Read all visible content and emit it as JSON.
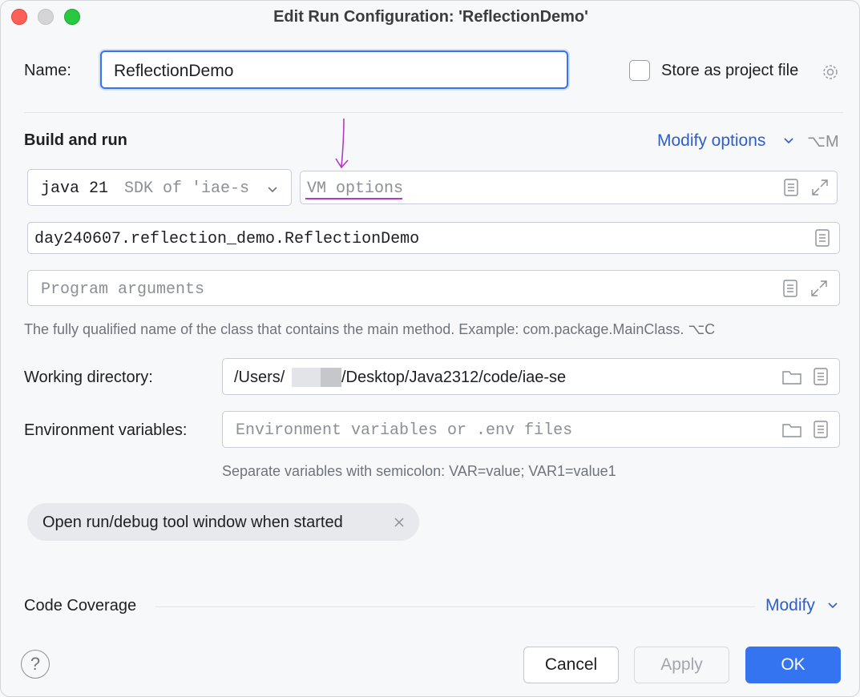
{
  "window": {
    "title": "Edit Run Configuration: 'ReflectionDemo'"
  },
  "name_row": {
    "label": "Name:",
    "value": "ReflectionDemo",
    "store_label": "Store as project file",
    "store_checked": false
  },
  "build_and_run": {
    "heading": "Build and run",
    "modify_options_label": "Modify options",
    "modify_options_shortcut": "⌥M",
    "sdk": {
      "main": "java 21",
      "detail": "SDK of 'iae-s"
    },
    "vm_options_placeholder": "VM options",
    "main_class_value": "day240607.reflection_demo.ReflectionDemo",
    "program_args_placeholder": "Program arguments",
    "main_class_hint": "The fully qualified name of the class that contains the main method. Example: com.package.MainClass. ⌥C"
  },
  "working_directory": {
    "label": "Working directory:",
    "value_prefix": "/Users/",
    "value_suffix": "/Desktop/Java2312/code/iae-se"
  },
  "environment": {
    "label": "Environment variables:",
    "placeholder": "Environment variables or .env files",
    "hint": "Separate variables with semicolon: VAR=value; VAR1=value1"
  },
  "chip": {
    "label": "Open run/debug tool window when started"
  },
  "code_coverage": {
    "label": "Code Coverage",
    "modify_label": "Modify"
  },
  "footer": {
    "help_symbol": "?",
    "cancel_label": "Cancel",
    "apply_label": "Apply",
    "ok_label": "OK"
  },
  "colors": {
    "accent": "#3574f0",
    "link": "#2e5dce",
    "annotation": "#b23bc2"
  }
}
